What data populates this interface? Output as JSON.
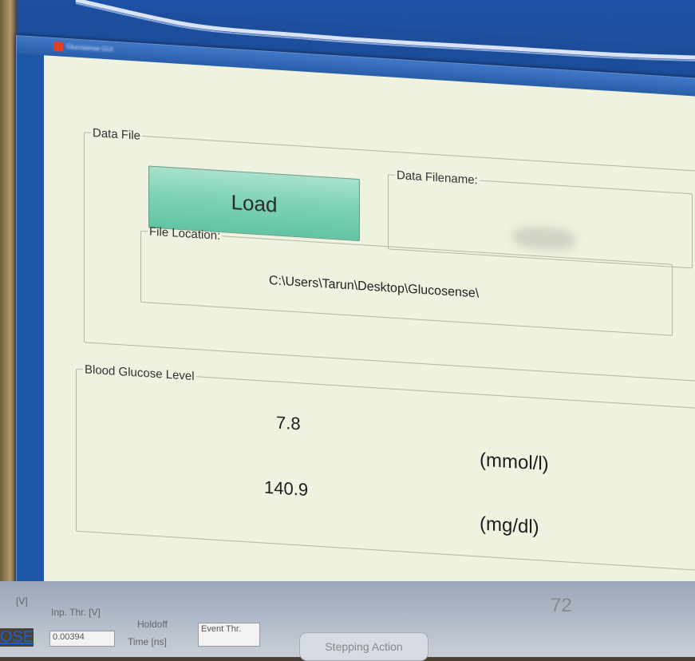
{
  "window": {
    "title": "Glucosense GUI"
  },
  "data_file": {
    "legend": "Data File",
    "load_label": "Load",
    "filename_legend": "Data Filename:",
    "location_legend": "File Location:",
    "location_value": "C:\\Users\\Tarun\\Desktop\\Glucosense\\"
  },
  "glucose": {
    "legend": "Blood Glucose Level",
    "mmol_value": "7.8",
    "mmol_unit": "(mmol/l)",
    "mgdl_value": "140.9",
    "mgdl_unit": "(mg/dl)"
  },
  "lower_toolbar": {
    "v_label": "[V]",
    "inp_thr_label": "Inp. Thr. [V]",
    "inp_thr_value": "0.00394",
    "holdoff_label": "Holdoff",
    "time_label": "Time [ns]",
    "event_thr_label": "Event Thr.",
    "stepping_label": "Stepping Action"
  },
  "overlay": {
    "page_number": "72",
    "link_text": "OSE"
  },
  "colors": {
    "desktop_blue": "#1d4f9e",
    "panel_bg": "#eef2df",
    "load_button": "#7fd3b6"
  }
}
